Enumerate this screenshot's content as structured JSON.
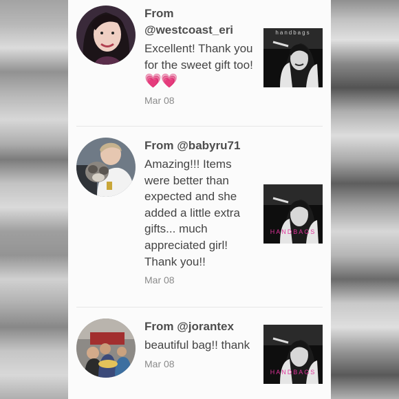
{
  "reviews": [
    {
      "from_label": "From",
      "username": "@westcoast_eri",
      "message": "Excellent! Thank you for the sweet gift too!",
      "emoji": "💗💗",
      "date": "Mar 08",
      "thumb_text": "handbags"
    },
    {
      "from_label": "From",
      "username": "@babyru71",
      "message": "Amazing!!! Items were better than expected and she added a little extra gifts... much appreciated girl! Thank you!!",
      "date": "Mar 08",
      "thumb_text": "HANDBAGS"
    },
    {
      "from_label": "From",
      "username": "@jorantex",
      "message": "beautiful bag!! thank",
      "date": "Mar 08",
      "thumb_text": "HANDBAGS"
    }
  ],
  "colors": {
    "panel_bg": "#fbfbfb",
    "text": "#444444",
    "date": "#8a8a8a",
    "heart": "#f24b6a",
    "brand_pink": "#e0329a"
  }
}
